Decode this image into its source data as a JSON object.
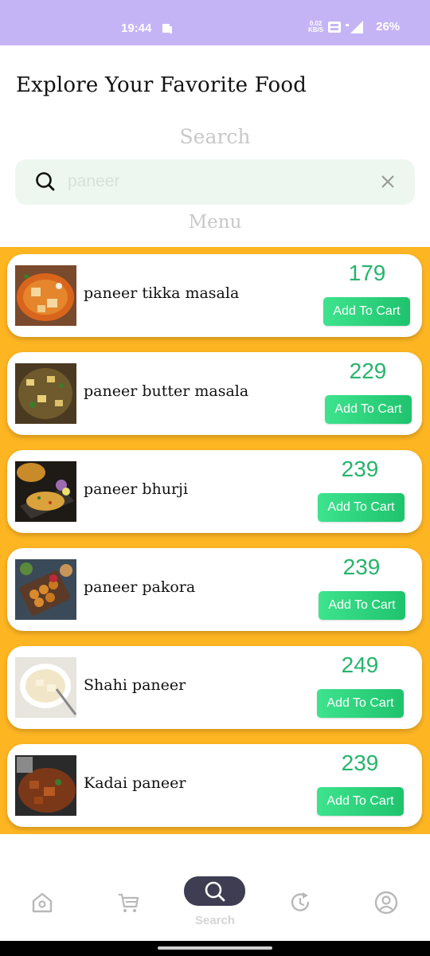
{
  "status_bar": {
    "time": "19:44",
    "net_speed_value": "0.02",
    "net_speed_unit": "KB/S",
    "battery": "26%"
  },
  "header": {
    "title": "Explore Your Favorite Food"
  },
  "search": {
    "label": "Search",
    "value": "paneer"
  },
  "menu": {
    "label": "Menu",
    "items": [
      {
        "name": "paneer tikka masala",
        "price": "179",
        "button": "Add To Cart"
      },
      {
        "name": "paneer butter masala",
        "price": "229",
        "button": "Add To Cart"
      },
      {
        "name": "paneer bhurji",
        "price": "239",
        "button": "Add To Cart"
      },
      {
        "name": "paneer pakora",
        "price": "239",
        "button": "Add To Cart"
      },
      {
        "name": "Shahi paneer",
        "price": "249",
        "button": "Add To Cart"
      },
      {
        "name": "Kadai paneer",
        "price": "239",
        "button": "Add To Cart"
      }
    ]
  },
  "bottom_nav": {
    "active_label": "Search",
    "icons": [
      "home-icon",
      "cart-icon",
      "search-icon",
      "history-icon",
      "profile-icon"
    ]
  },
  "colors": {
    "status_bar": "#c5b4f5",
    "menu_background": "#fdb522",
    "price": "#27b46c",
    "button": "#2fd37c",
    "nav_active": "#3f3d52"
  }
}
